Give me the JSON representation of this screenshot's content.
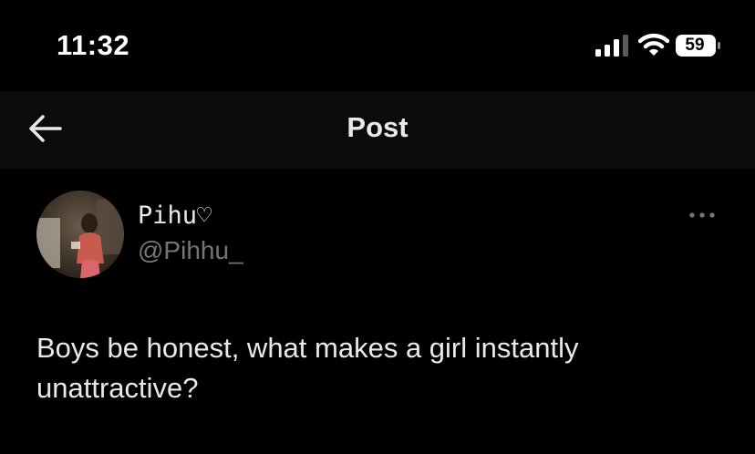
{
  "status_bar": {
    "time": "11:32",
    "battery_level": "59",
    "icons": [
      "signal-icon",
      "wifi-icon",
      "battery-icon"
    ]
  },
  "nav": {
    "back_icon": "back-arrow-icon",
    "title": "Post"
  },
  "post": {
    "author": {
      "display_name": "Pihu♡",
      "handle": "@Pihhu_",
      "avatar": "profile-photo"
    },
    "more_icon": "more-options-icon",
    "text": "Boys be honest, what makes a girl instantly unattractive?"
  },
  "colors": {
    "background": "#000000",
    "nav_background": "#0b0b0b",
    "primary_text": "#e7e9ea",
    "secondary_text": "#71767b"
  }
}
